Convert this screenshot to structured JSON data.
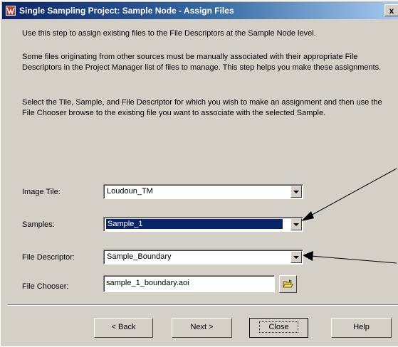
{
  "window": {
    "title": "Single Sampling Project: Sample Node - Assign Files",
    "close_label": "x"
  },
  "instructions": [
    "Use this step to assign existing files to the File Descriptors at the Sample Node level.",
    "Some files originating from other sources must be manually associated with their appropriate File Descriptors in the Project Manager list of files to manage. This step helps you make these assignments.",
    "Select the Tile, Sample, and File Descriptor for which you wish to make an assignment and then use the File Chooser browse to the existing file you want to associate with the selected Sample."
  ],
  "form": {
    "image_tile": {
      "label": "Image Tile:",
      "value": "Loudoun_TM"
    },
    "samples": {
      "label": "Samples:",
      "value": "Sample_1"
    },
    "file_descriptor": {
      "label": "File Descriptor:",
      "value": "Sample_Boundary"
    },
    "file_chooser": {
      "label": "File Chooser:",
      "value": "sample_1_boundary.aoi"
    }
  },
  "buttons": {
    "back": "< Back",
    "next": "Next >",
    "close": "Close",
    "help": "Help"
  },
  "icons": {
    "title": "app-icon",
    "browse": "folder-browse-icon",
    "dropdown": "chevron-down-icon"
  },
  "colors": {
    "title_bar": "#0a246a",
    "selection": "#0a246a",
    "dialog_bg": "#d4d0c8"
  }
}
